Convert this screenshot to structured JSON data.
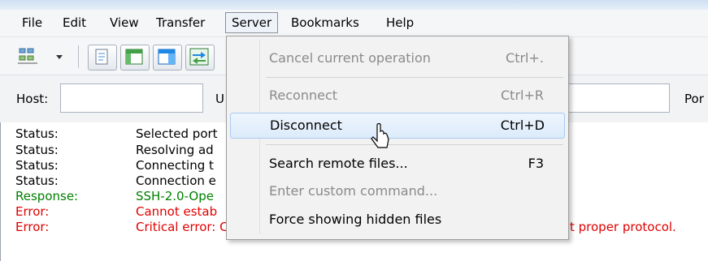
{
  "menubar": {
    "items": [
      "File",
      "Edit",
      "View",
      "Transfer",
      "Server",
      "Bookmarks",
      "Help"
    ],
    "open_item": "Server"
  },
  "quickconnect": {
    "host_label": "Host:",
    "user_label_partial": "U",
    "port_label_partial": "Por",
    "host_value": ""
  },
  "log": {
    "rows": [
      {
        "type": "Status:",
        "message": "Selected port",
        "color": "#000000"
      },
      {
        "type": "Status:",
        "message": "Resolving ad",
        "color": "#000000"
      },
      {
        "type": "Status:",
        "message": "Connecting t",
        "color": "#000000"
      },
      {
        "type": "Status:",
        "message": "Connection e",
        "color": "#000000"
      },
      {
        "type": "Response:",
        "message": "SSH-2.0-Ope",
        "color": "#008000"
      },
      {
        "type": "Error:",
        "message": "Cannot estab",
        "color": "#e00000"
      },
      {
        "type": "Error:",
        "message": "Critical error: Could not connect to server",
        "color": "#e00000"
      }
    ],
    "overflow_text": "t proper protocol."
  },
  "server_menu": {
    "items": [
      {
        "label": "Cancel current operation",
        "shortcut": "Ctrl+.",
        "enabled": false
      },
      {
        "label": "Reconnect",
        "shortcut": "Ctrl+R",
        "enabled": false
      },
      {
        "label": "Disconnect",
        "shortcut": "Ctrl+D",
        "enabled": true,
        "hovered": true
      },
      {
        "label": "Search remote files...",
        "shortcut": "F3",
        "enabled": true
      },
      {
        "label": "Enter custom command...",
        "shortcut": "",
        "enabled": false
      },
      {
        "label": "Force showing hidden files",
        "shortcut": "",
        "enabled": true
      }
    ]
  },
  "icons": [
    "site-manager-icon",
    "dropdown-arrow-icon",
    "message-log-icon",
    "local-tree-icon",
    "remote-tree-icon",
    "transfer-queue-icon",
    "mouse-pointer-icon"
  ]
}
